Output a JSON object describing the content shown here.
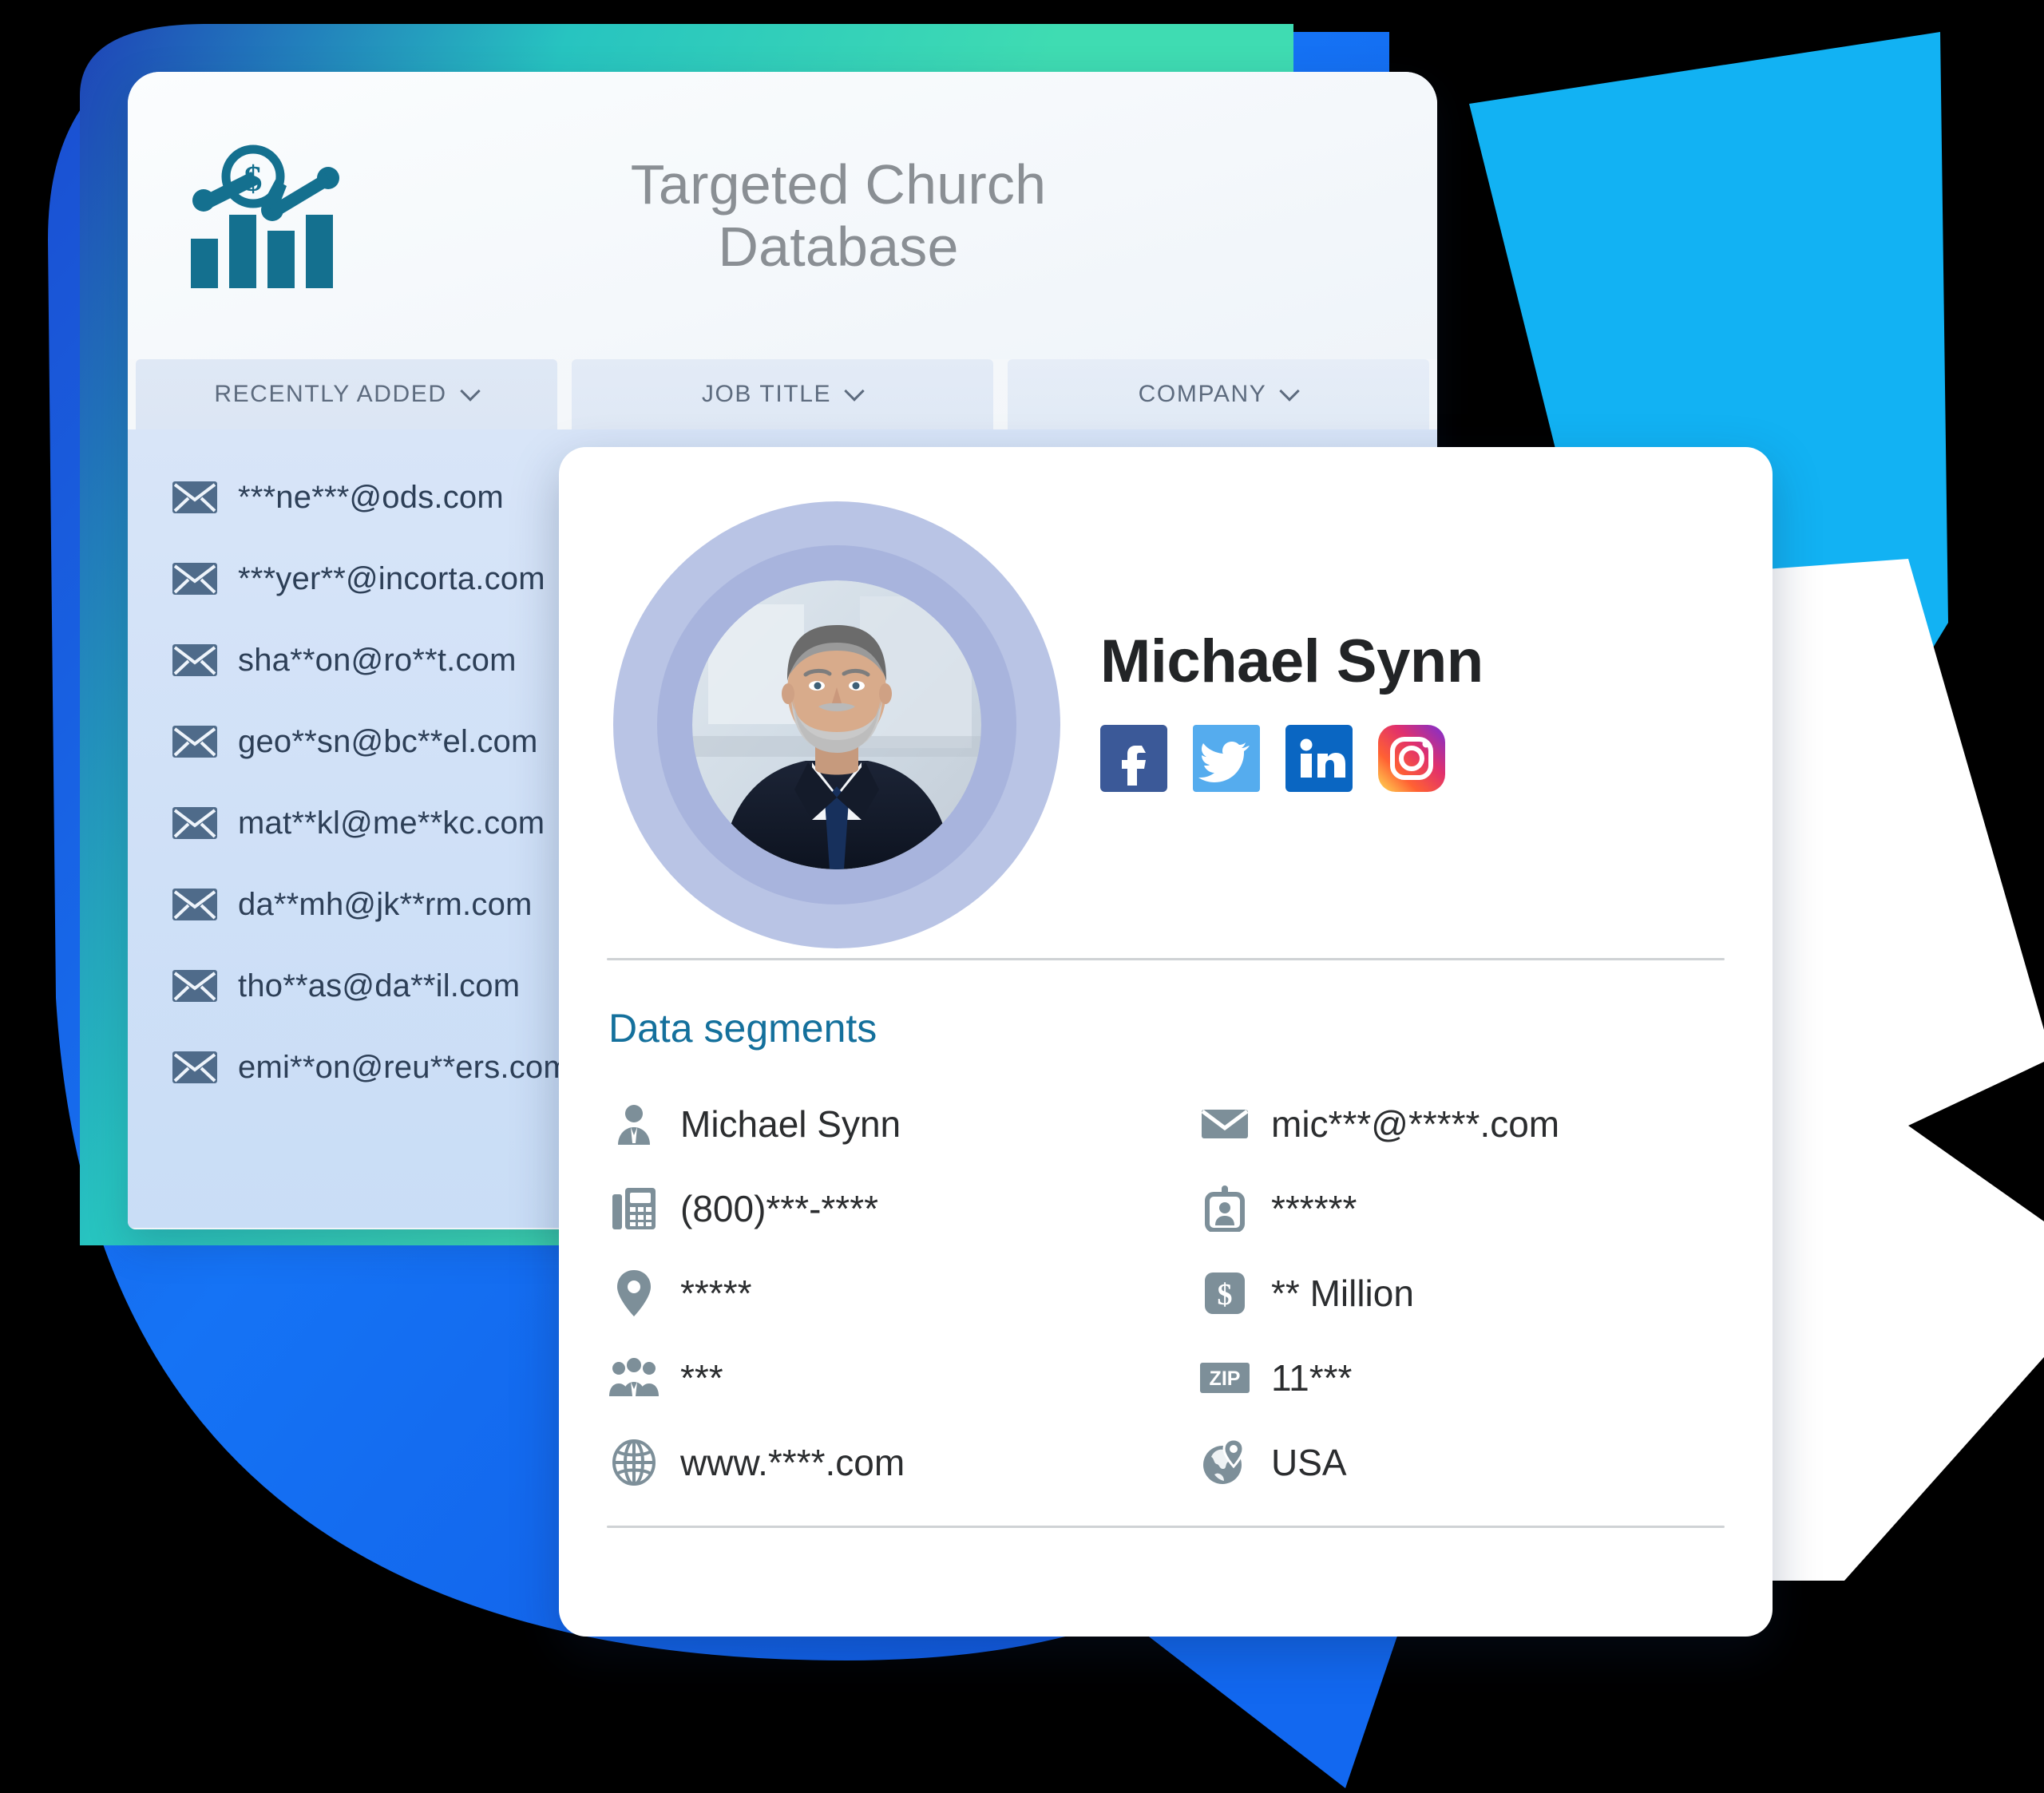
{
  "database_card": {
    "logo_icon": "bar-chart-dollar-icon",
    "title_line1": "Targeted Church",
    "title_line2": "Database",
    "filters": [
      {
        "label": "RECENTLY ADDED",
        "icon": "chevron-down-icon"
      },
      {
        "label": "JOB TITLE",
        "icon": "chevron-down-icon"
      },
      {
        "label": "COMPANY",
        "icon": "chevron-down-icon"
      }
    ],
    "emails": [
      "***ne***@ods.com",
      "***yer**@incorta.com",
      "sha**on@ro**t.com",
      "geo**sn@bc**el.com",
      "mat**kl@me**kc.com",
      "da**mh@jk**rm.com",
      "tho**as@da**il.com",
      "emi**on@reu**ers.com"
    ],
    "email_icon": "envelope-icon"
  },
  "profile_card": {
    "avatar_icon": "user-avatar-photo",
    "name": "Michael Synn",
    "socials": [
      {
        "name": "facebook-icon",
        "color": "#3b5998"
      },
      {
        "name": "twitter-icon",
        "color": "#55acee"
      },
      {
        "name": "linkedin-icon",
        "color": "#0a66c2"
      },
      {
        "name": "instagram-icon",
        "color": "#e1306c"
      }
    ],
    "segments_title": "Data segments",
    "segments_left": [
      {
        "icon": "person-icon",
        "value": "Michael Synn"
      },
      {
        "icon": "fax-machine-icon",
        "value": "(800)***-****"
      },
      {
        "icon": "location-pin-icon",
        "value": "*****"
      },
      {
        "icon": "people-group-icon",
        "value": "***"
      },
      {
        "icon": "globe-icon",
        "value": "www.****.com"
      }
    ],
    "segments_right": [
      {
        "icon": "envelope-icon",
        "value": "mic***@*****.com"
      },
      {
        "icon": "id-badge-icon",
        "value": "******"
      },
      {
        "icon": "dollar-icon",
        "value": "** Million"
      },
      {
        "icon": "zip-code-icon",
        "value": "11***"
      },
      {
        "icon": "globe-pin-icon",
        "value": "USA"
      }
    ]
  },
  "colors": {
    "brand_teal": "#0f6f9c",
    "accent_cyan": "#12b2f3",
    "accent_blue": "#1268f0",
    "accent_green": "#3ad9b4",
    "card_blue": "#cfe0f7"
  }
}
